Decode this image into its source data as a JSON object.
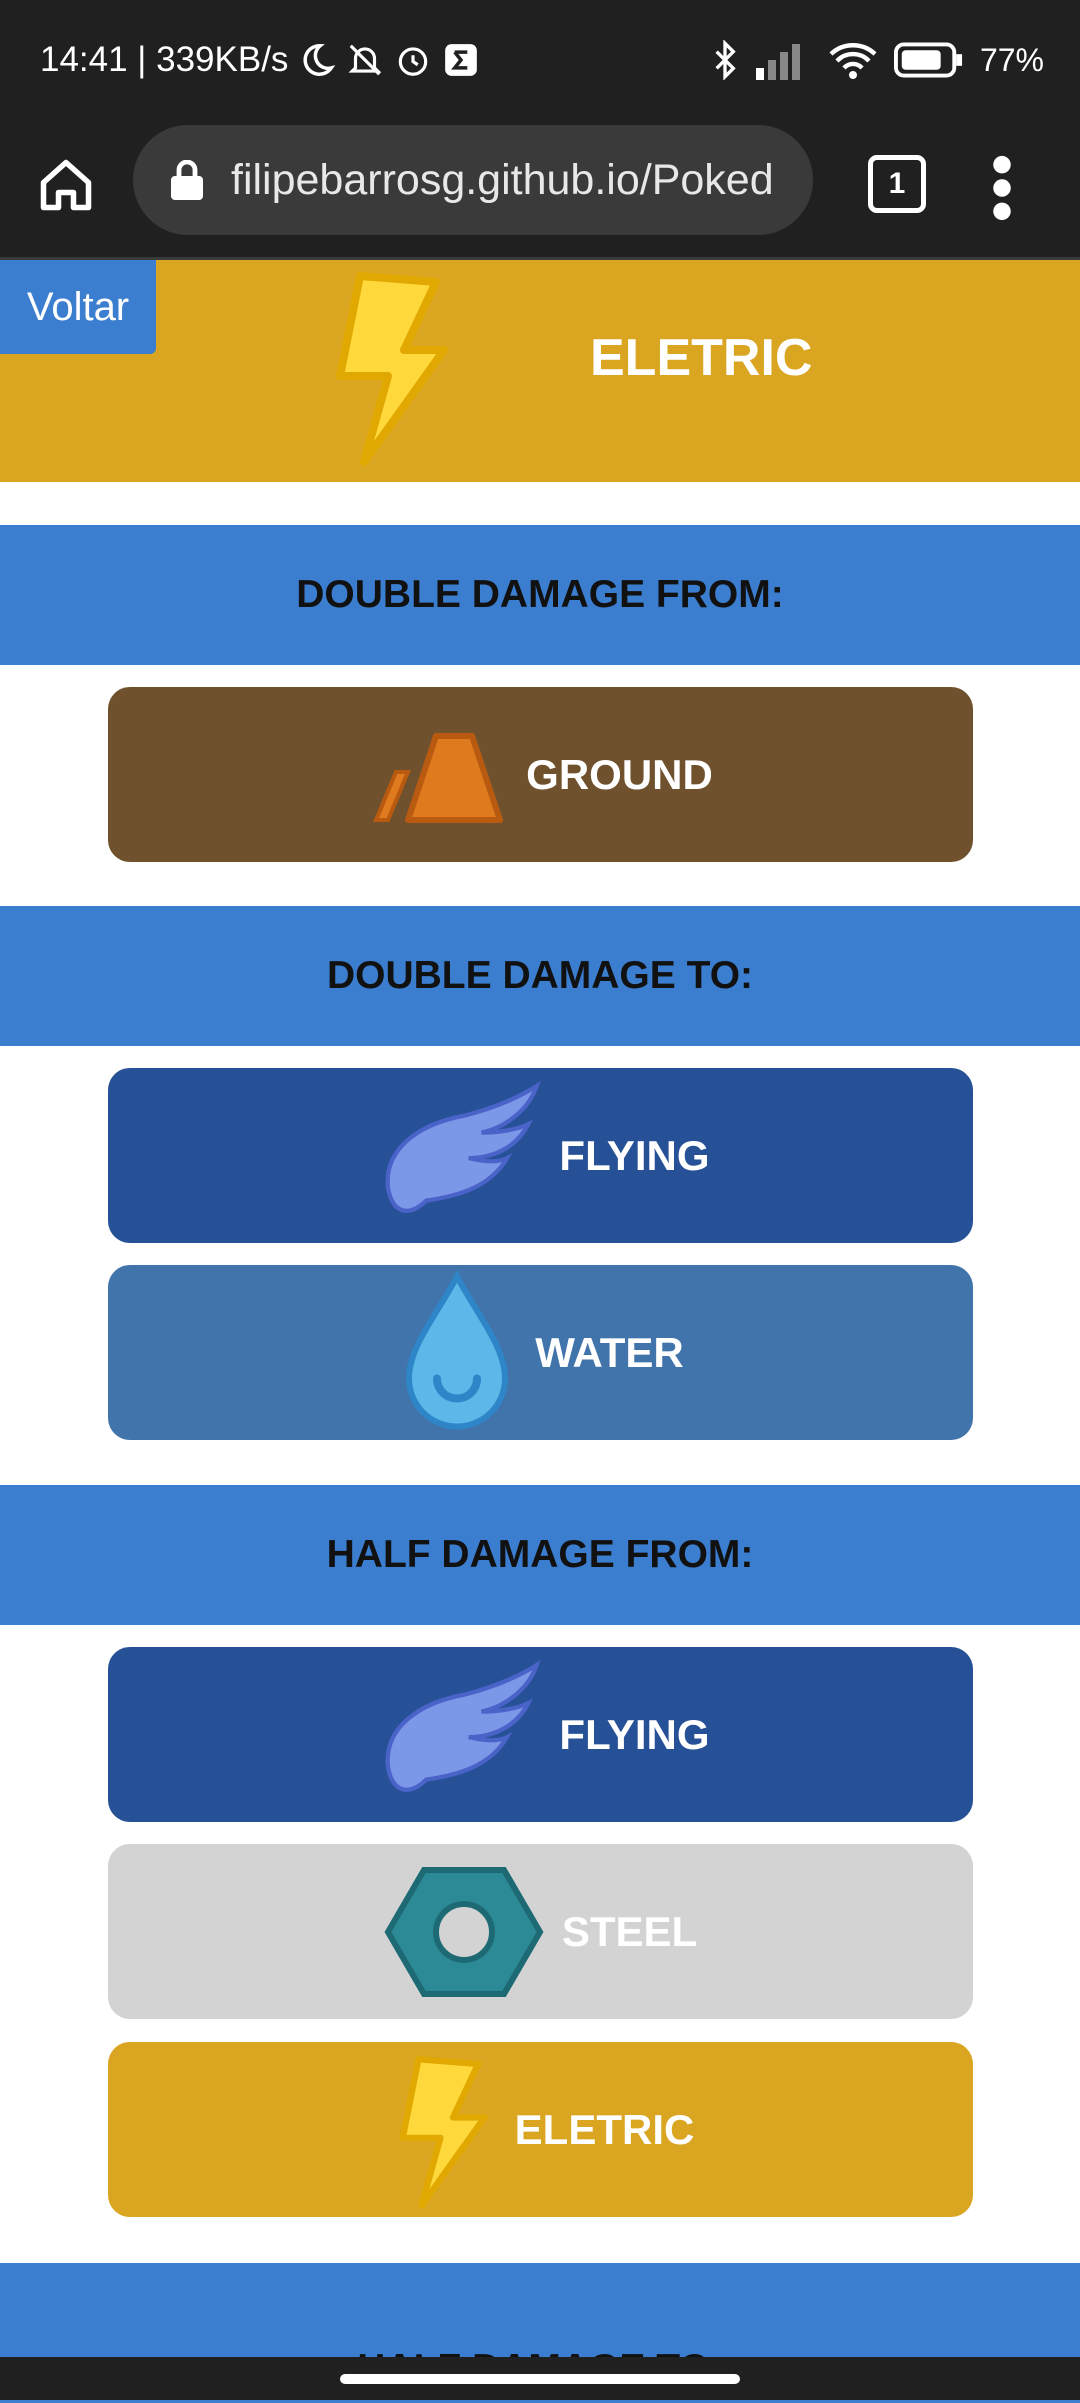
{
  "status_bar": {
    "time_speed": "14:41 | 339KB/s",
    "battery": "77%"
  },
  "browser": {
    "url": "filipebarrosg.github.io/Poked",
    "tab_count": "1"
  },
  "page": {
    "back_label": "Voltar",
    "type_title": "ELETRIC",
    "sections": [
      {
        "title": "DOUBLE DAMAGE FROM:",
        "types": [
          {
            "name": "GROUND",
            "icon": "ground-icon",
            "color": "#70512D"
          }
        ]
      },
      {
        "title": "DOUBLE DAMAGE TO:",
        "types": [
          {
            "name": "FLYING",
            "icon": "wing-icon",
            "color": "#265197"
          },
          {
            "name": "WATER",
            "icon": "water-drop-icon",
            "color": "#4174AA"
          }
        ]
      },
      {
        "title": "HALF DAMAGE FROM:",
        "types": [
          {
            "name": "FLYING",
            "icon": "wing-icon",
            "color": "#265197"
          },
          {
            "name": "STEEL",
            "icon": "hex-nut-icon",
            "color": "#D3D3D3"
          },
          {
            "name": "ELETRIC",
            "icon": "lightning-icon",
            "color": "#DAA520"
          }
        ]
      },
      {
        "title": "HALF DAMAGE TO:",
        "types": []
      }
    ]
  },
  "colors": {
    "header_bg": "#DAA520",
    "section_bg": "#3B7DCF",
    "back_button_bg": "#3B7DCF"
  }
}
